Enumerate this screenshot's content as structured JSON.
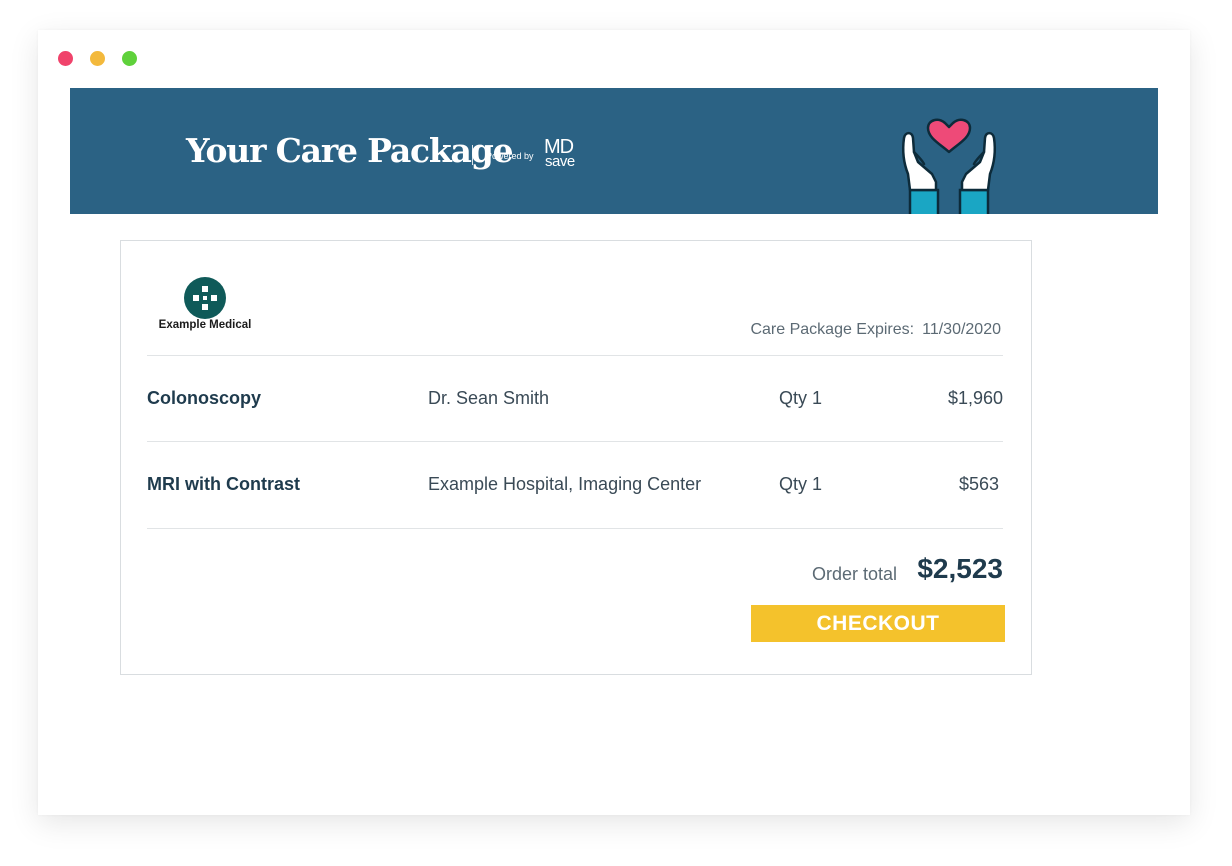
{
  "window": {
    "controls": [
      "close",
      "minimize",
      "maximize"
    ]
  },
  "banner": {
    "title": "Your Care Package",
    "powered_by": "Powered by",
    "brand_md": "MD",
    "brand_save": "save",
    "illustration": "hands-heart-icon",
    "background": "#2b6284"
  },
  "card": {
    "provider_name": "Example Medical",
    "expiry_label": "Care Package Expires:",
    "expiry_date": "11/30/2020",
    "items": [
      {
        "name": "Colonoscopy",
        "provider": "Dr. Sean Smith",
        "qty": "Qty 1",
        "price": "$1,960"
      },
      {
        "name": "MRI with Contrast",
        "provider": "Example Hospital, Imaging Center",
        "qty": "Qty 1",
        "price": "$563"
      }
    ],
    "total_label": "Order total",
    "total_value": "$2,523",
    "checkout_label": "CHECKOUT"
  },
  "colors": {
    "accent": "#f4c22c",
    "text_dark": "#1f3b4d",
    "logo": "#0f5a59",
    "heart": "#ee4a78",
    "sleeve": "#1aa6c4"
  }
}
